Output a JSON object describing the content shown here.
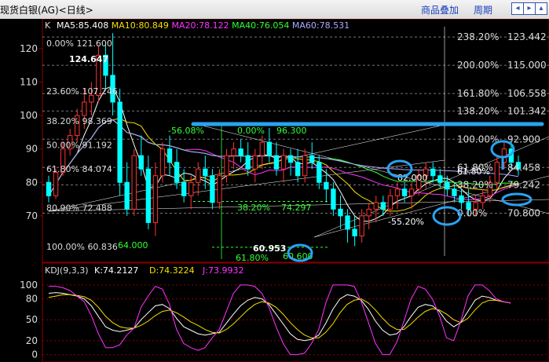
{
  "window": {
    "title": "现货白银(AG)<日线>",
    "menu_overlay": "商品叠加",
    "menu_period": "周期"
  },
  "price_panel": {
    "label": "K",
    "ma": [
      {
        "name": "MA5",
        "value": "85.408",
        "color": "#ffffff"
      },
      {
        "name": "MA10",
        "value": "80.849",
        "color": "#f5e000"
      },
      {
        "name": "MA20",
        "value": "78.122",
        "color": "#ff33ff"
      },
      {
        "name": "MA40",
        "value": "76.054",
        "color": "#33ff33"
      },
      {
        "name": "MA60",
        "value": "78.531",
        "color": "#aaaaff"
      }
    ],
    "y_ticks": [
      "120",
      "110",
      "100",
      "90",
      "80",
      "70"
    ],
    "high_label": "124.647",
    "low_label": "60.953",
    "fib_right": [
      {
        "pct": "238.20%",
        "val": "123.442"
      },
      {
        "pct": "200.00%",
        "val": "115.000"
      },
      {
        "pct": "161.80%",
        "val": "106.558"
      },
      {
        "pct": "138.20%",
        "val": "101.342"
      },
      {
        "pct": "100.00%",
        "val": "92.900"
      },
      {
        "pct": "61.80%",
        "val": "84.458"
      },
      {
        "pct": "38.20%",
        "val": "79.242"
      },
      {
        "pct": "0.00%",
        "val": "70.800"
      }
    ],
    "fib_left": [
      {
        "pct": "0.00%",
        "val": "121.600"
      },
      {
        "pct": "23.60%",
        "val": "107.246"
      },
      {
        "pct": "38.20%",
        "val": "98.369"
      },
      {
        "pct": "50.00%",
        "val": "91.192"
      },
      {
        "pct": "61.80%",
        "val": "84.074"
      },
      {
        "pct": "80.90%",
        "val": "72.488"
      },
      {
        "pct": "100.00%",
        "val": "60.836"
      }
    ],
    "fib_mid": [
      {
        "text": "-56.08%"
      },
      {
        "text": "0.00%"
      },
      {
        "text": "96.300"
      },
      {
        "text": "38.20%"
      },
      {
        "text": "74.297"
      },
      {
        "text": "61.80%"
      },
      {
        "text": "60.600"
      },
      {
        "text": "64.000"
      },
      {
        "text": "-55.20%"
      },
      {
        "text": "82.000"
      },
      {
        "text": "61.80%"
      }
    ]
  },
  "kdj_panel": {
    "label": "KDJ(9,3,3)",
    "k": "K:74.2127",
    "d": "D:74.3224",
    "j": "J:73.9932",
    "y_ticks": [
      "100",
      "80",
      "50",
      "20",
      "0"
    ]
  },
  "chart_data": {
    "type": "candlestick",
    "candles": [
      [
        80,
        82,
        74,
        76
      ],
      [
        76,
        84,
        75,
        83
      ],
      [
        83,
        92,
        82,
        90
      ],
      [
        90,
        96,
        88,
        94
      ],
      [
        94,
        102,
        92,
        100
      ],
      [
        100,
        108,
        96,
        104
      ],
      [
        104,
        110,
        100,
        106
      ],
      [
        106,
        121,
        104,
        118
      ],
      [
        118,
        122,
        108,
        112
      ],
      [
        112,
        124.6,
        100,
        104
      ],
      [
        104,
        108,
        76,
        80
      ],
      [
        80,
        86,
        70,
        72
      ],
      [
        72,
        90,
        70,
        88
      ],
      [
        88,
        94,
        82,
        84
      ],
      [
        84,
        88,
        66,
        68
      ],
      [
        68,
        86,
        64,
        82
      ],
      [
        82,
        92,
        80,
        90
      ],
      [
        90,
        94,
        82,
        86
      ],
      [
        86,
        90,
        78,
        80
      ],
      [
        80,
        84,
        74,
        76
      ],
      [
        76,
        82,
        72,
        80
      ],
      [
        80,
        86,
        76,
        84
      ],
      [
        84,
        88,
        78,
        82
      ],
      [
        82,
        84,
        72,
        74
      ],
      [
        74,
        84,
        72,
        82
      ],
      [
        82,
        90,
        80,
        88
      ],
      [
        88,
        92,
        84,
        90
      ],
      [
        90,
        93,
        86,
        88
      ],
      [
        88,
        92,
        82,
        84
      ],
      [
        84,
        90,
        80,
        88
      ],
      [
        88,
        94,
        84,
        92
      ],
      [
        92,
        96.3,
        86,
        88
      ],
      [
        88,
        92,
        82,
        84
      ],
      [
        84,
        90,
        80,
        88
      ],
      [
        88,
        90,
        82,
        86
      ],
      [
        86,
        90,
        80,
        82
      ],
      [
        82,
        90,
        80,
        88
      ],
      [
        88,
        92,
        84,
        86
      ],
      [
        86,
        88,
        78,
        80
      ],
      [
        80,
        84,
        74,
        78
      ],
      [
        78,
        80,
        70,
        72
      ],
      [
        72,
        76,
        66,
        70
      ],
      [
        70,
        72,
        62,
        66
      ],
      [
        66,
        70,
        60.95,
        64
      ],
      [
        64,
        72,
        62,
        70
      ],
      [
        70,
        74,
        66,
        72
      ],
      [
        72,
        76,
        68,
        74
      ],
      [
        74,
        76,
        70,
        72
      ],
      [
        72,
        78,
        70,
        76
      ],
      [
        76,
        80,
        72,
        78
      ],
      [
        78,
        80,
        74,
        76
      ],
      [
        76,
        80,
        72,
        78
      ],
      [
        78,
        84,
        76,
        82
      ],
      [
        82,
        86,
        78,
        84
      ],
      [
        84,
        86,
        80,
        82
      ],
      [
        82,
        84,
        78,
        80
      ],
      [
        80,
        82,
        76,
        78
      ],
      [
        78,
        80,
        74,
        76
      ],
      [
        76,
        78,
        72,
        74
      ],
      [
        74,
        78,
        70,
        72
      ],
      [
        72,
        76,
        70,
        74
      ],
      [
        74,
        78,
        72,
        76
      ],
      [
        76,
        82,
        74,
        80
      ],
      [
        80,
        88,
        78,
        86
      ],
      [
        86,
        92,
        84,
        90
      ],
      [
        90,
        92,
        84,
        86
      ],
      [
        86,
        88,
        82,
        84
      ]
    ],
    "kdj": {
      "k": [
        88,
        89,
        88,
        86,
        84,
        80,
        70,
        55,
        40,
        35,
        33,
        35,
        38,
        50,
        60,
        70,
        72,
        66,
        52,
        40,
        35,
        30,
        28,
        30,
        32,
        45,
        58,
        70,
        78,
        82,
        80,
        72,
        58,
        44,
        30,
        22,
        20,
        22,
        28,
        45,
        65,
        80,
        86,
        84,
        78,
        65,
        48,
        35,
        28,
        30,
        40,
        55,
        68,
        72,
        70,
        62,
        48,
        40,
        46,
        62,
        78,
        84,
        82,
        78,
        76,
        74
      ],
      "d": [
        82,
        84,
        86,
        86,
        85,
        83,
        78,
        68,
        55,
        46,
        40,
        38,
        38,
        42,
        48,
        56,
        62,
        64,
        60,
        54,
        47,
        42,
        36,
        32,
        31,
        36,
        44,
        54,
        64,
        72,
        76,
        74,
        68,
        58,
        46,
        36,
        28,
        24,
        24,
        32,
        44,
        60,
        72,
        78,
        80,
        74,
        64,
        52,
        42,
        36,
        36,
        44,
        54,
        62,
        66,
        64,
        58,
        50,
        46,
        52,
        64,
        74,
        78,
        78,
        76,
        74
      ],
      "j": [
        98,
        98,
        96,
        92,
        84,
        76,
        56,
        30,
        10,
        10,
        14,
        28,
        38,
        68,
        84,
        98,
        94,
        72,
        36,
        16,
        10,
        6,
        10,
        24,
        36,
        62,
        88,
        100,
        100,
        98,
        88,
        68,
        40,
        16,
        0,
        0,
        2,
        16,
        36,
        74,
        100,
        100,
        100,
        98,
        76,
        46,
        16,
        0,
        0,
        18,
        48,
        80,
        98,
        94,
        80,
        56,
        24,
        20,
        48,
        84,
        100,
        100,
        92,
        80,
        76,
        74
      ]
    },
    "ylim_price": [
      58,
      127
    ],
    "ylim_kdj": [
      -5,
      110
    ]
  }
}
